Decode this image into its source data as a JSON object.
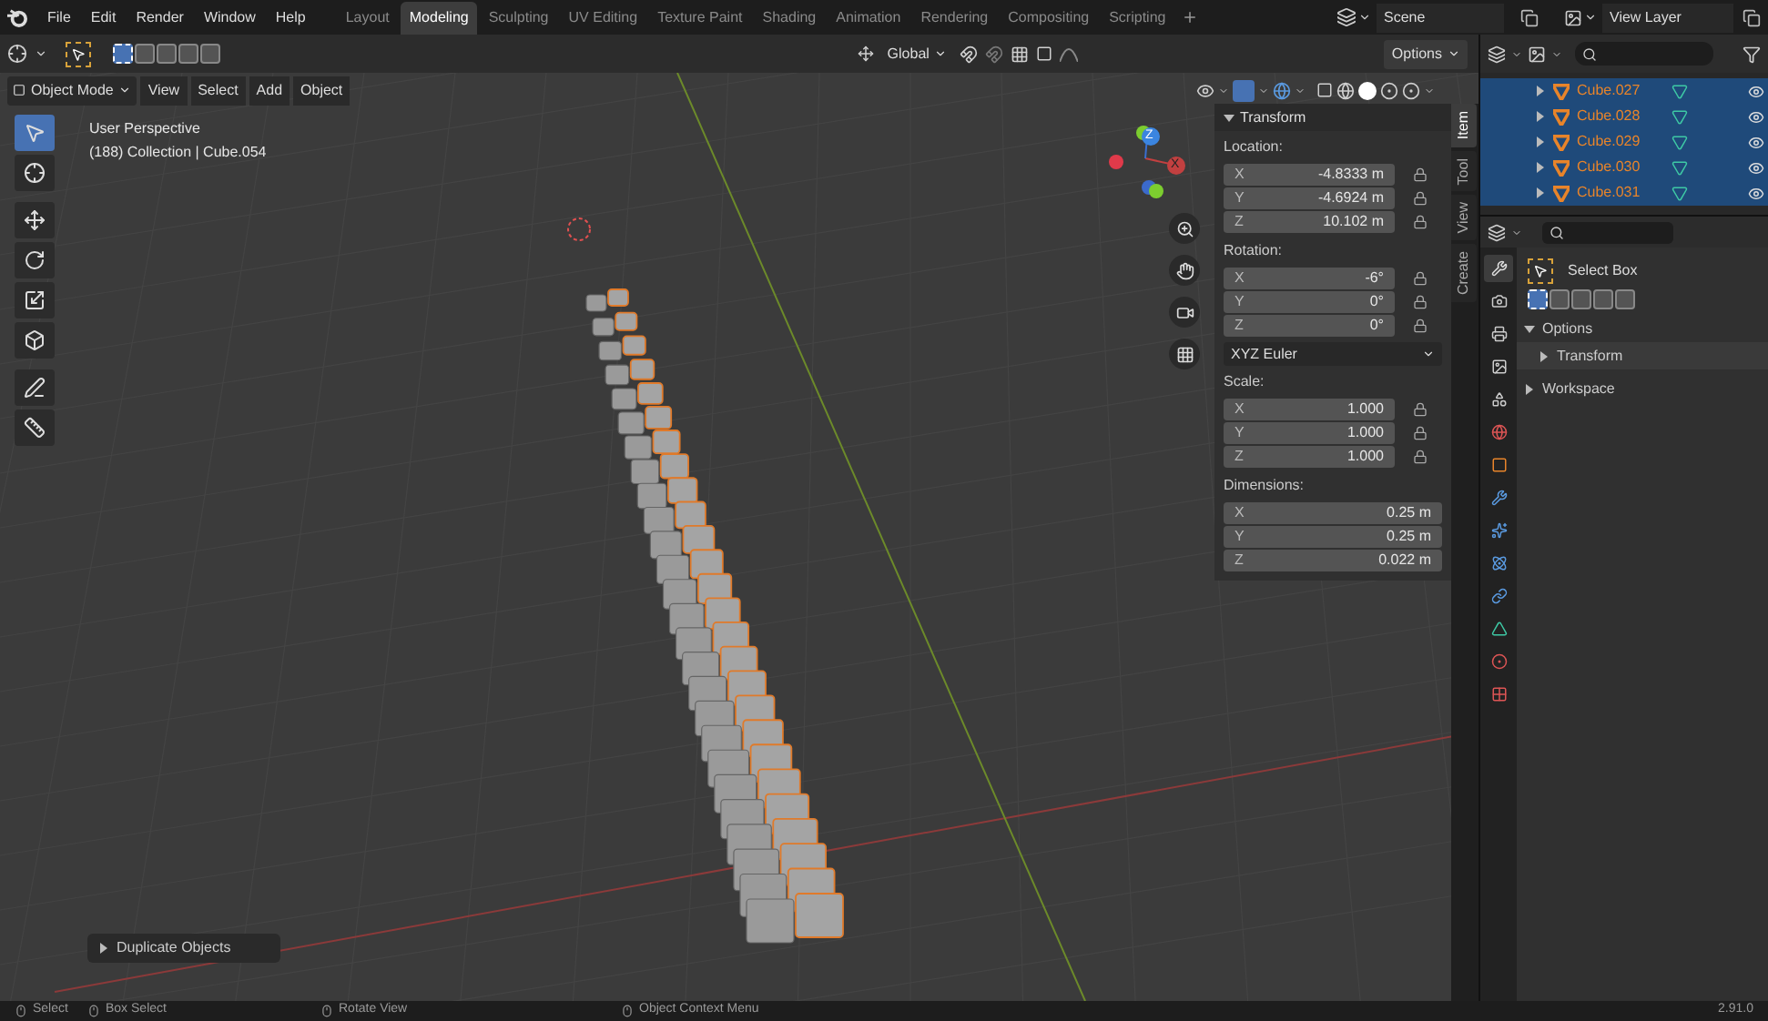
{
  "menu": [
    "File",
    "Edit",
    "Render",
    "Window",
    "Help"
  ],
  "workspaces": [
    {
      "label": "Layout",
      "selected": false
    },
    {
      "label": "Modeling",
      "selected": true
    },
    {
      "label": "Sculpting",
      "selected": false
    },
    {
      "label": "UV Editing",
      "selected": false
    },
    {
      "label": "Texture Paint",
      "selected": false
    },
    {
      "label": "Shading",
      "selected": false
    },
    {
      "label": "Animation",
      "selected": false
    },
    {
      "label": "Rendering",
      "selected": false
    },
    {
      "label": "Compositing",
      "selected": false
    },
    {
      "label": "Scripting",
      "selected": false
    }
  ],
  "scene": "Scene",
  "view_layer": "View Layer",
  "tool_header": {
    "orientation": "Global",
    "options": "Options"
  },
  "viewport_header": {
    "mode": "Object Mode",
    "menus": [
      "View",
      "Select",
      "Add",
      "Object"
    ]
  },
  "viewport_info": [
    "User Perspective",
    "(188) Collection | Cube.054"
  ],
  "gizmo": {
    "z": "Z",
    "x": "X"
  },
  "transform": {
    "title": "Transform",
    "groups": [
      {
        "label": "Location:",
        "lock": true,
        "rows": [
          {
            "axis": "X",
            "value": "-4.8333 m"
          },
          {
            "axis": "Y",
            "value": "-4.6924 m"
          },
          {
            "axis": "Z",
            "value": "10.102 m"
          }
        ]
      },
      {
        "label": "Rotation:",
        "lock": true,
        "rows": [
          {
            "axis": "X",
            "value": "-6°"
          },
          {
            "axis": "Y",
            "value": "0°"
          },
          {
            "axis": "Z",
            "value": "0°"
          }
        ],
        "mode": "XYZ Euler"
      },
      {
        "label": "Scale:",
        "lock": true,
        "rows": [
          {
            "axis": "X",
            "value": "1.000"
          },
          {
            "axis": "Y",
            "value": "1.000"
          },
          {
            "axis": "Z",
            "value": "1.000"
          }
        ]
      },
      {
        "label": "Dimensions:",
        "lock": false,
        "rows": [
          {
            "axis": "X",
            "value": "0.25 m"
          },
          {
            "axis": "Y",
            "value": "0.25 m"
          },
          {
            "axis": "Z",
            "value": "0.022 m"
          }
        ]
      }
    ]
  },
  "sidebar_tabs": [
    {
      "label": "Item",
      "selected": true
    },
    {
      "label": "Tool",
      "selected": false
    },
    {
      "label": "View",
      "selected": false
    },
    {
      "label": "Create",
      "selected": false
    }
  ],
  "outliner": [
    {
      "name": "Cube.027",
      "selected": true
    },
    {
      "name": "Cube.028",
      "selected": true
    },
    {
      "name": "Cube.029",
      "selected": true
    },
    {
      "name": "Cube.030",
      "selected": true
    },
    {
      "name": "Cube.031",
      "selected": true
    }
  ],
  "properties_tabs": [
    {
      "kind": "tool",
      "selected": true
    },
    {
      "kind": "render",
      "selected": false
    },
    {
      "kind": "output",
      "selected": false
    },
    {
      "kind": "view_layer",
      "selected": false
    },
    {
      "kind": "scene",
      "selected": false
    },
    {
      "kind": "world",
      "selected": false
    },
    {
      "kind": "object",
      "selected": false
    },
    {
      "kind": "modifiers",
      "selected": false
    },
    {
      "kind": "particles",
      "selected": false
    },
    {
      "kind": "physics",
      "selected": false
    },
    {
      "kind": "constraints",
      "selected": false
    },
    {
      "kind": "data",
      "selected": false
    },
    {
      "kind": "material",
      "selected": false
    },
    {
      "kind": "texture",
      "selected": false
    }
  ],
  "tool_settings": {
    "tool": "Select Box",
    "sections": [
      {
        "label": "Options",
        "expanded": true,
        "children": [
          {
            "label": "Transform",
            "expanded": false
          }
        ]
      },
      {
        "label": "Workspace",
        "expanded": false
      }
    ]
  },
  "last_operator": "Duplicate Objects",
  "status_bar": {
    "items": [
      "Select",
      "Box Select",
      "Rotate View",
      "Object Context Menu"
    ],
    "version": "2.91.0"
  }
}
